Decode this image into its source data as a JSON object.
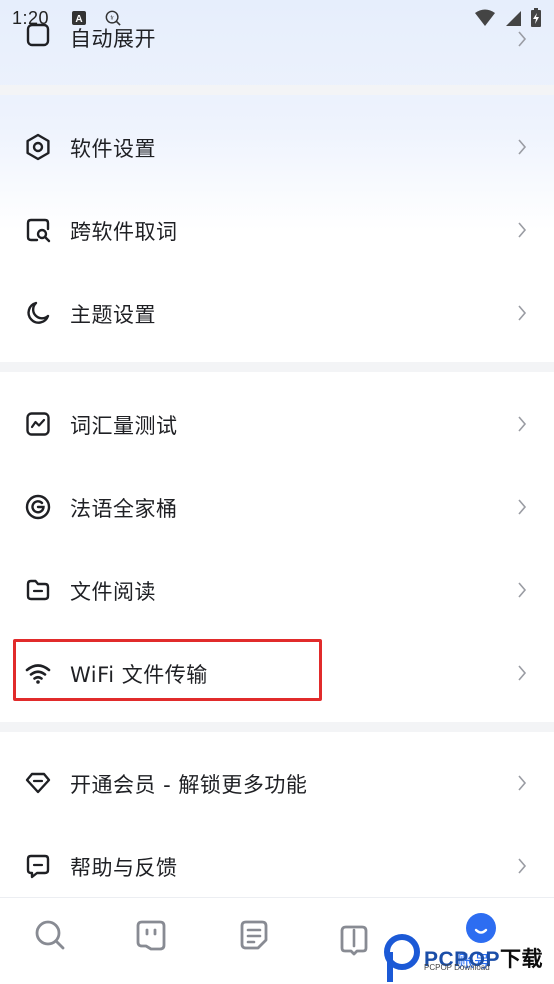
{
  "status_bar": {
    "time": "1:20"
  },
  "menu": {
    "partial_item": {
      "label": "自动展开"
    },
    "section_settings": [
      {
        "label": "软件设置",
        "icon": "hexagon-settings-icon"
      },
      {
        "label": "跨软件取词",
        "icon": "search-word-icon"
      },
      {
        "label": "主题设置",
        "icon": "moon-icon"
      }
    ],
    "section_tools": [
      {
        "label": "词汇量测试",
        "icon": "chart-icon"
      },
      {
        "label": "法语全家桶",
        "icon": "circle-g-icon"
      },
      {
        "label": "文件阅读",
        "icon": "folder-icon"
      },
      {
        "label": "WiFi 文件传输",
        "icon": "wifi-icon"
      }
    ],
    "section_more": [
      {
        "label": "开通会员 - 解锁更多功能",
        "icon": "diamond-icon"
      },
      {
        "label": "帮助与反馈",
        "icon": "feedback-icon"
      }
    ]
  },
  "tab_bar": {
    "tabs": [
      {
        "name": "search",
        "icon": "search-icon"
      },
      {
        "name": "translate",
        "icon": "chat-icon"
      },
      {
        "name": "notes",
        "icon": "document-icon"
      },
      {
        "name": "book",
        "icon": "book-icon"
      },
      {
        "name": "account",
        "label": "账号",
        "icon": "avatar-icon"
      }
    ],
    "active_color": "#2b6ff3"
  },
  "watermark": {
    "brand": "PCPOP",
    "suffix": "下载",
    "sub": "PCPOP Download"
  },
  "highlight_color": "#e12b2b"
}
